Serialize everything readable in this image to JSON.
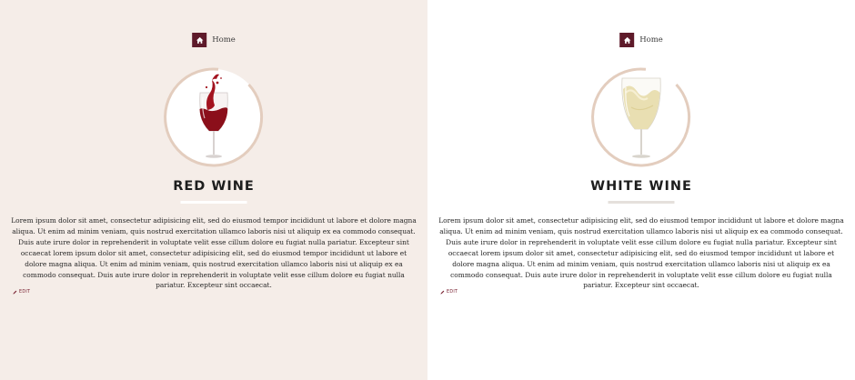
{
  "colors": {
    "accent": "#5e1a2a",
    "left_bg": "#f5ede8",
    "right_bg": "#ffffff",
    "ring": "#e3cdbe",
    "red_wine": "#8b0f1a",
    "white_wine": "#e6dcae"
  },
  "panels": [
    {
      "breadcrumb": {
        "icon": "home-icon",
        "label": "Home"
      },
      "image_icon": "red-wine-glass",
      "title": "RED WINE",
      "body": "Lorem ipsum dolor sit amet, consectetur adipisicing elit, sed do eiusmod tempor incididunt ut labore et dolore magna aliqua. Ut enim ad minim veniam, quis nostrud exercitation ullamco laboris nisi ut aliquip ex ea commodo consequat. Duis aute irure dolor in reprehenderit in voluptate velit esse cillum dolore eu fugiat nulla pariatur. Excepteur sint occaecat lorem ipsum dolor sit amet, consectetur adipisicing elit, sed do eiusmod tempor incididunt ut labore et dolore magna aliqua. Ut enim ad minim veniam, quis nostrud exercitation ullamco laboris nisi ut aliquip ex ea commodo consequat. Duis aute irure dolor in reprehenderit in voluptate velit esse cillum dolore eu fugiat nulla pariatur. Excepteur sint occaecat.",
      "edit_label": "EDIT"
    },
    {
      "breadcrumb": {
        "icon": "home-icon",
        "label": "Home"
      },
      "image_icon": "white-wine-glass",
      "title": "WHITE WINE",
      "body": "Lorem ipsum dolor sit amet, consectetur adipisicing elit, sed do eiusmod tempor incididunt ut labore et dolore magna aliqua. Ut enim ad minim veniam, quis nostrud exercitation ullamco laboris nisi ut aliquip ex ea commodo consequat. Duis aute irure dolor in reprehenderit in voluptate velit esse cillum dolore eu fugiat nulla pariatur. Excepteur sint occaecat lorem ipsum dolor sit amet, consectetur adipisicing elit, sed do eiusmod tempor incididunt ut labore et dolore magna aliqua. Ut enim ad minim veniam, quis nostrud exercitation ullamco laboris nisi ut aliquip ex ea commodo consequat. Duis aute irure dolor in reprehenderit in voluptate velit esse cillum dolore eu fugiat nulla pariatur. Excepteur sint occaecat.",
      "edit_label": "EDIT"
    }
  ]
}
